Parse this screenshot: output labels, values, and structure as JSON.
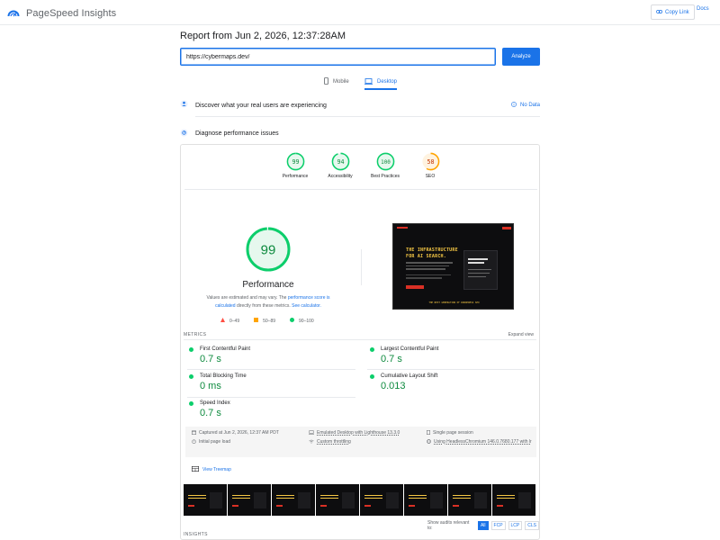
{
  "app": {
    "name": "PageSpeed Insights"
  },
  "header": {
    "copy_link": "Copy Link",
    "docs": "Docs"
  },
  "report": {
    "title": "Report from Jun 2, 2026, 12:37:28AM"
  },
  "url_field": {
    "value": "https://cybermaps.dev/"
  },
  "analyze_button": "Analyze",
  "tabs": [
    {
      "label": "Mobile",
      "active": false
    },
    {
      "label": "Desktop",
      "active": true
    }
  ],
  "field_data": {
    "title": "Discover what your real users are experiencing",
    "status": "No Data"
  },
  "diagnose": {
    "title": "Diagnose performance issues"
  },
  "categories": [
    {
      "label": "Performance",
      "score": 99,
      "color": "#0cce6b"
    },
    {
      "label": "Accessibility",
      "score": 94,
      "color": "#0cce6b"
    },
    {
      "label": "Best Practices",
      "score": 100,
      "color": "#0cce6b"
    },
    {
      "label": "SEO",
      "score": 58,
      "color": "#ffa400"
    }
  ],
  "performance": {
    "score": 99,
    "label": "Performance",
    "explain_prefix": "Values are estimated and may vary. The",
    "explain_link1": "performance score is calculated",
    "explain_mid": "directly from these metrics.",
    "explain_link2": "See calculator."
  },
  "legend": [
    {
      "label": "0–49"
    },
    {
      "label": "50–89"
    },
    {
      "label": "90–100"
    }
  ],
  "screenshot": {
    "headline_1": "THE INFRASTRUCTURE",
    "headline_2": "FOR AI SEARCH.",
    "footer": "THE NEXT GENERATION OF WORDPRESS SEO"
  },
  "metrics": {
    "header": "METRICS",
    "expand": "Expand view",
    "items": [
      {
        "label": "First Contentful Paint",
        "value": "0.7 s"
      },
      {
        "label": "Largest Contentful Paint",
        "value": "0.7 s"
      },
      {
        "label": "Total Blocking Time",
        "value": "0 ms"
      },
      {
        "label": "Cumulative Layout Shift",
        "value": "0.013"
      },
      {
        "label": "Speed Index",
        "value": "0.7 s"
      }
    ]
  },
  "run_info": {
    "captured": "Captured at Jun 2, 2026, 12:37 AM PDT",
    "load": "Initial page load",
    "device": "Emulated Desktop with Lighthouse 13.3.0",
    "throttling": "Custom throttling",
    "session": "Single page session",
    "browser": "Using HeadlessChromium 146.0.7680.177 with lr"
  },
  "treemap": "View Treemap",
  "audits_filter": {
    "label": "Show audits relevant to:",
    "options": [
      "All",
      "FCP",
      "LCP",
      "CLS"
    ]
  },
  "insights": "INSIGHTS"
}
